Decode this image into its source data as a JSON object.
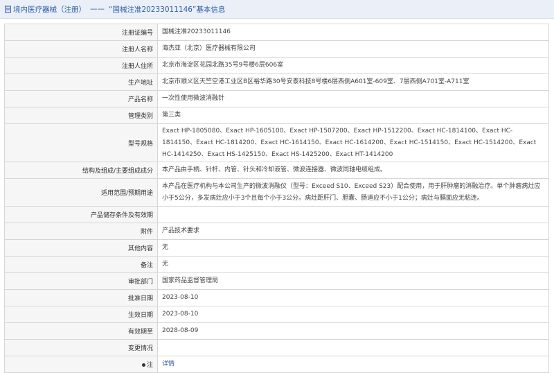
{
  "header": {
    "section": "境内医疗器械（注册）",
    "separator": "——",
    "record_title": "“国械注准20233011146”基本信息"
  },
  "rows": [
    {
      "label": "注册证编号",
      "value": "国械注准20233011146"
    },
    {
      "label": "注册人名称",
      "value": "海杰亚（北京）医疗器械有限公司"
    },
    {
      "label": "注册人住所",
      "value": "北京市海淀区花园北路35号9号楼6层606室"
    },
    {
      "label": "生产地址",
      "value": "北京市顺义区天竺空港工业区B区裕华路30号安泰科技8号楼6层西侧A601室-609室、7层西侧A701室-A711室"
    },
    {
      "label": "产品名称",
      "value": "一次性使用微波消融针"
    },
    {
      "label": "管理类别",
      "value": "第三类"
    },
    {
      "label": "型号规格",
      "value": "Exact HP-1805080、Exact HP-1605100、Exact HP-1507200、Exact HP-1512200、Exact HC-1814100、Exact HC-1814150、Exact HC-1814200、Exact HC-1614150、Exact HC-1614200、Exact HC-1514150、Exact HC-1514200、Exact HC-1414250、Exact HS-1425150、Exact HS-1425200、Exact HT-1414200"
    },
    {
      "label": "结构及组成/主要组成成分",
      "value": "本产品由手柄、针杆、内管、针头和冷却液管、微波连接器、微波同轴电缆组成。"
    },
    {
      "label": "适用范围/预期用途",
      "value": "本产品在医疗机构与本公司生产的微波消融仪（型号：Exceed S10、Exceed S23）配合使用，用于肝肿瘤的消融治疗。单个肿瘤病灶应小于5公分，多发病灶应小于3个且每个小于3公分。病灶距肝门、胆囊、肠道应不小于1公分；病灶与膈面应无粘连。"
    },
    {
      "label": "产品储存条件及有效期",
      "value": ""
    },
    {
      "label": "附件",
      "value": "产品技术要求"
    },
    {
      "label": "其他内容",
      "value": "无"
    },
    {
      "label": "备注",
      "value": "无"
    },
    {
      "label": "审批部门",
      "value": "国家药品监督管理局"
    },
    {
      "label": "批准日期",
      "value": "2023-08-10"
    },
    {
      "label": "生效日期",
      "value": "2023-08-10"
    },
    {
      "label": "有效期至",
      "value": "2028-08-09"
    },
    {
      "label": "变更情况",
      "value": ""
    },
    {
      "label": "注",
      "value": "详情"
    }
  ]
}
